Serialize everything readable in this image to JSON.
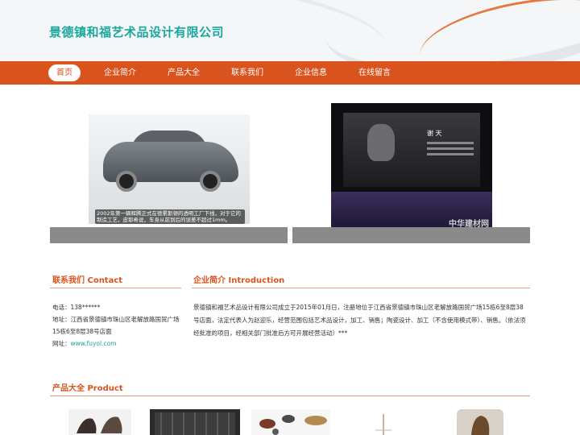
{
  "header": {
    "site_title": "景德镇和福艺术品设计有限公司",
    "brand_color": "#1aa89c"
  },
  "nav": {
    "accent": "#d9531e",
    "items": [
      {
        "label": "首页",
        "active": true
      },
      {
        "label": "企业简介",
        "active": false
      },
      {
        "label": "产品大全",
        "active": false
      },
      {
        "label": "联系我们",
        "active": false
      },
      {
        "label": "企业信息",
        "active": false
      },
      {
        "label": "在线留言",
        "active": false
      }
    ]
  },
  "banner": {
    "car_caption": "2002年第一辆辉腾正式在德累斯顿的透明工厂下线，对于它的制造工艺，皮耶希说，车身从前到后的误差不超过1mm。",
    "screen_name": "谢 天",
    "watermark": "中华建材网"
  },
  "contact": {
    "title": "联系我们 Contact",
    "phone": "电话：138******",
    "address": "地址：江西省景德镇市珠山区老解放路国贸广场15栋6至8层38号店面",
    "website_label": "网址：",
    "website": "www.fuyol.com"
  },
  "intro": {
    "title": "企业简介 Introduction",
    "text": "景德镇和福艺术品设计有限公司成立于2015年01月日，注册地位于江西省景德镇市珠山区老解放路国贸广场15栋6至8层38号店面，法定代表人为赵迎乐，经营范围包括艺术品设计，加工、销售；陶瓷设计、加工（不含使用模式带）、销售。（依法须经批准的项目，经相关部门批准后方可开展经营活动）***"
  },
  "products": {
    "title": "产品大全 Product"
  }
}
